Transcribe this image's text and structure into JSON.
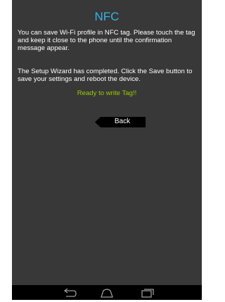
{
  "screen": {
    "title": "NFC",
    "paragraphs": [
      "You can save Wi-Fi profile in NFC tag. Please touch the tag and keep it close to the phone until the confirmation message appear.",
      "The Setup Wizard has completed. Click the Save button to save your settings and reboot the device."
    ],
    "status": "Ready to write Tag!!",
    "back_label": "Back"
  },
  "navbar": {
    "icons": [
      "back-nav-icon",
      "home-icon",
      "recent-apps-icon"
    ]
  },
  "colors": {
    "background": "#383838",
    "title": "#33b5e5",
    "status": "#99cc00",
    "button": "#000000",
    "navbar": "#000000"
  }
}
